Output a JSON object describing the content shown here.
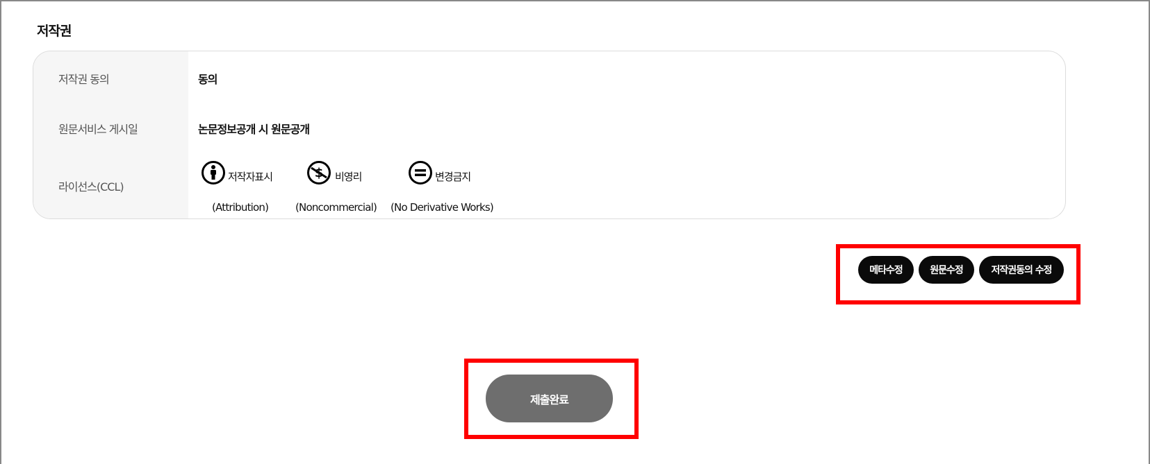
{
  "section": {
    "title": "저작권"
  },
  "rows": [
    {
      "label": "저작권 동의",
      "value": "동의"
    },
    {
      "label": "원문서비스 게시일",
      "value": "논문정보공개 시 원문공개"
    },
    {
      "label": "라이선스(CCL)"
    }
  ],
  "licenses": [
    {
      "icon": "attribution-icon",
      "name": "저작자표시",
      "en": "(Attribution)"
    },
    {
      "icon": "noncommercial-icon",
      "name": "비영리",
      "en": "(Noncommercial)"
    },
    {
      "icon": "no-derivatives-icon",
      "name": "변경금지",
      "en": "(No Derivative Works)"
    }
  ],
  "actions": {
    "meta_edit": "메타수정",
    "fulltext_edit": "원문수정",
    "copyright_edit": "저작권동의 수정"
  },
  "submit": {
    "label": "제출완료"
  },
  "colors": {
    "highlight": "#ff0000",
    "pill": "#0a0a0a",
    "submit": "#6e6e6e"
  }
}
